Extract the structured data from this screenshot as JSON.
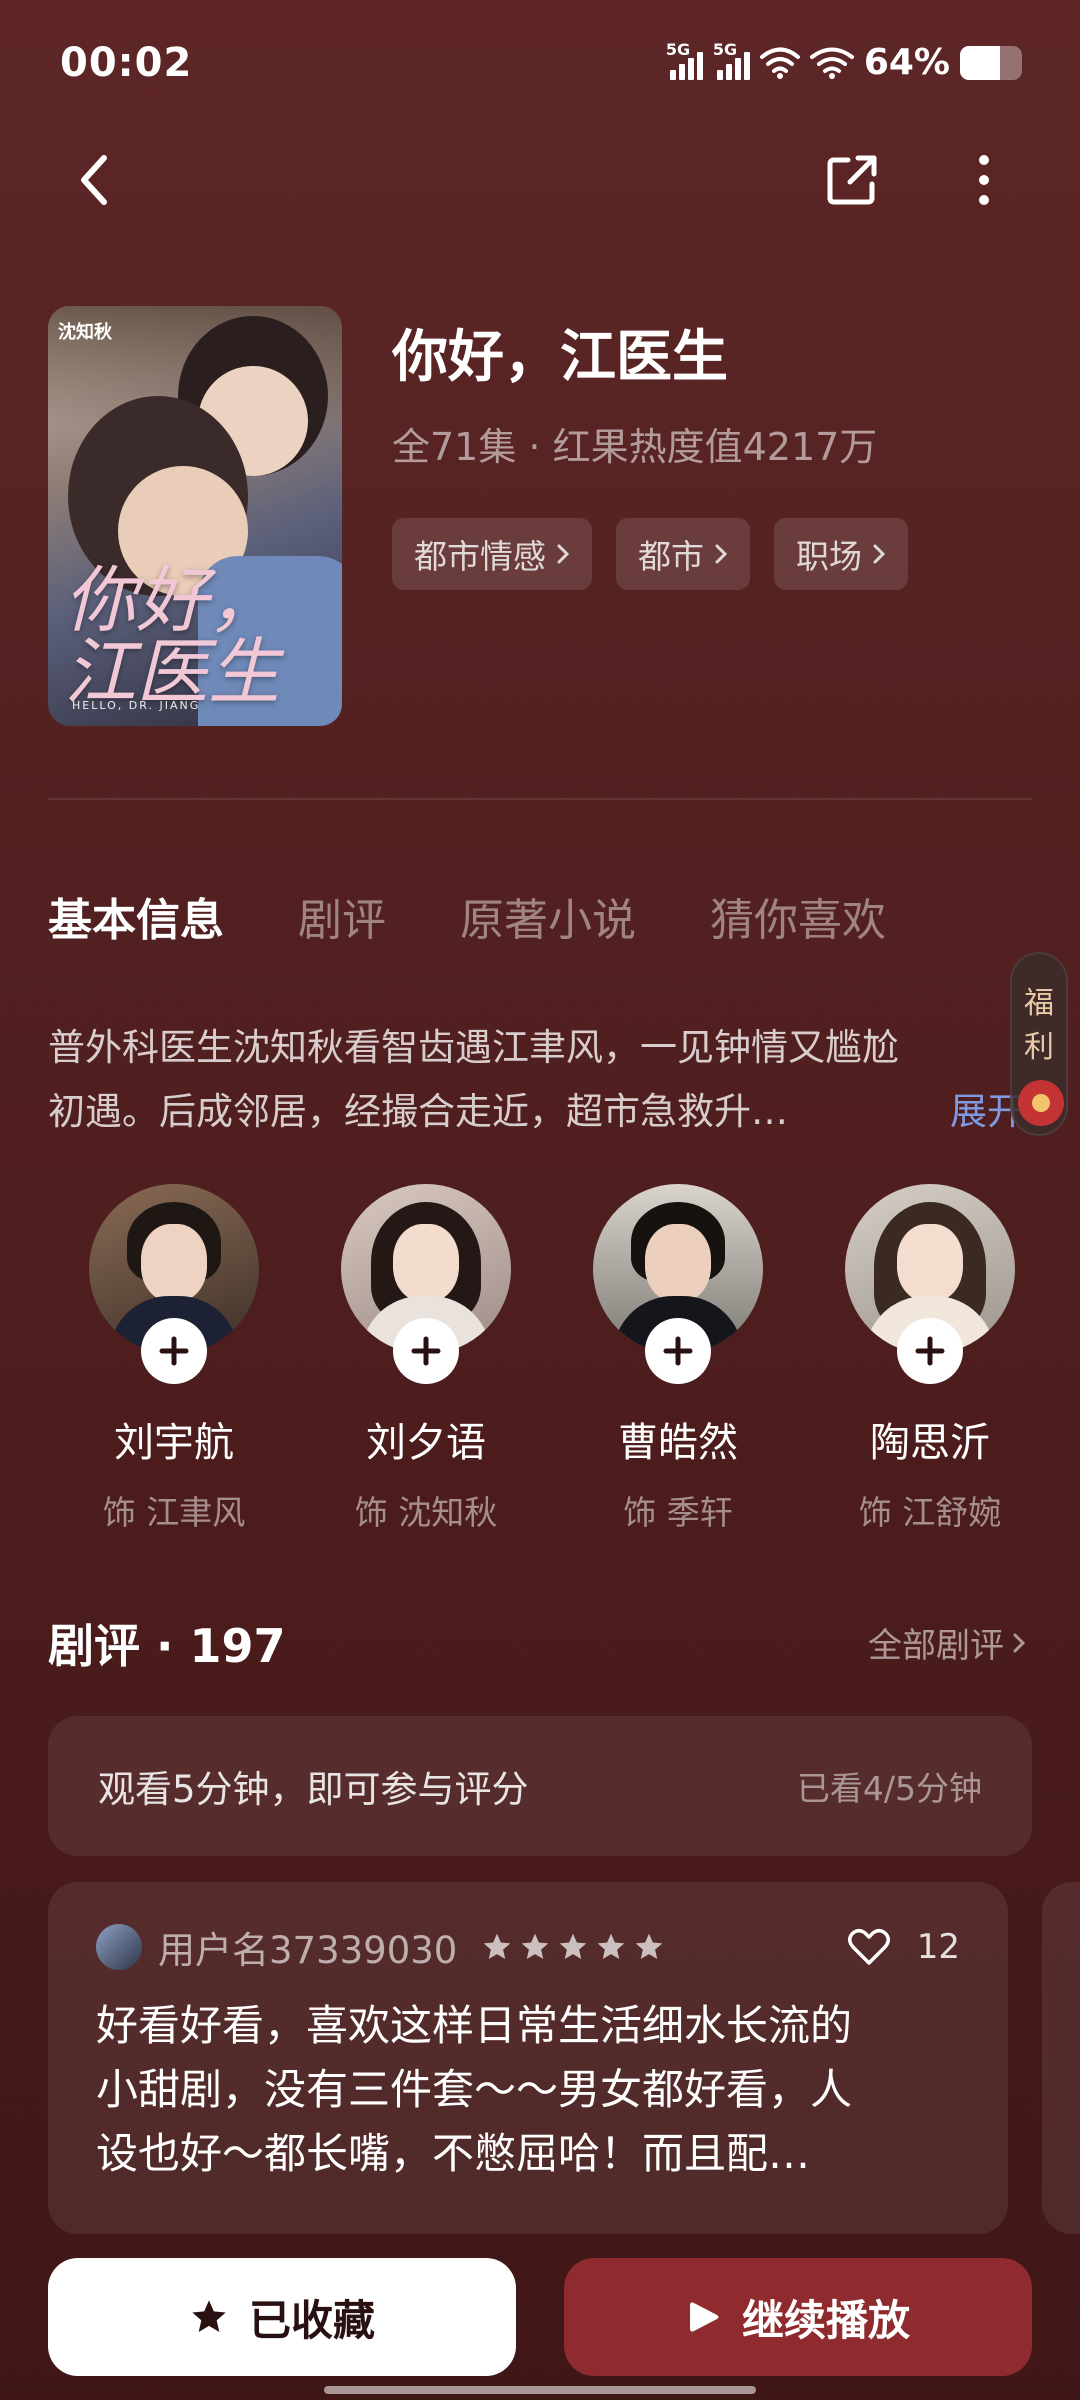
{
  "status_bar": {
    "time": "00:02",
    "net1": "5G",
    "net2": "5G",
    "battery": "64%",
    "battery_level": 0.64
  },
  "drama": {
    "title": "你好，江医生",
    "meta": "全71集 · 红果热度值4217万",
    "tags": [
      "都市情感",
      "都市",
      "职场"
    ],
    "poster": {
      "caption": "沈知秋",
      "title": "你好，江医生",
      "subtitle": "HELLO, DR. JIANG"
    }
  },
  "tabs": [
    "基本信息",
    "剧评",
    "原著小说",
    "猜你喜欢"
  ],
  "floating": {
    "line1": "福",
    "line2": "利"
  },
  "synopsis": {
    "line1": "普外科医生沈知秋看智齿遇江聿风，一见钟情又尴尬",
    "line2": "初遇。后成邻居，经撮合走近，超市急救升…",
    "expand": "展开"
  },
  "cast": [
    {
      "name": "刘宇航",
      "role": "饰 江聿风"
    },
    {
      "name": "刘夕语",
      "role": "饰 沈知秋"
    },
    {
      "name": "曹皓然",
      "role": "饰 季轩"
    },
    {
      "name": "陶思沂",
      "role": "饰 江舒婉"
    }
  ],
  "reviews": {
    "header": "剧评 · 197",
    "all_link": "全部剧评",
    "rate_prompt": "观看5分钟，即可参与评分",
    "rate_progress": "已看4/5分钟",
    "items": [
      {
        "user": "用户名37339030",
        "stars": 5,
        "likes": "12",
        "text_line1": "好看好看，喜欢这样日常生活细水长流的",
        "text_line2": "小甜剧，没有三件套～～男女都好看，人",
        "text_line3": "设也好～都长嘴，不憋屈哈！而且配…"
      }
    ]
  },
  "actions": {
    "favorite": "已收藏",
    "play": "继续播放"
  },
  "colors": {
    "accent": "#8f2b2e",
    "link": "#7f9ae0",
    "background": "#4e1d1d"
  },
  "icons": [
    "back-icon",
    "share-icon",
    "more-icon",
    "chevron-right-icon",
    "plus-icon",
    "heart-icon",
    "star-icon",
    "play-icon"
  ]
}
